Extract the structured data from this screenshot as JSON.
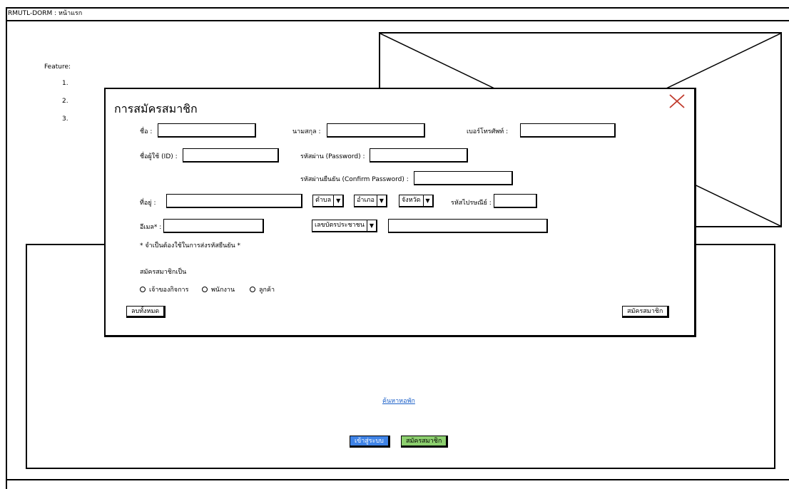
{
  "window": {
    "title": "RMUTL-DORM : หน้าแรก"
  },
  "background": {
    "feature_title": "Feature:",
    "feature_items": [
      "1.",
      "2.",
      "3."
    ],
    "search_link": "ค้นหาหอพัก",
    "login_button": "เข้าสู่ระบบ",
    "register_button": "สมัครสมาชิก"
  },
  "modal": {
    "title": "การสมัครสมาชิก",
    "fields": {
      "first_name_label": "ชื่อ :",
      "last_name_label": "นามสกุล :",
      "phone_label": "เบอร์โทรศัพท์ :",
      "username_label": "ชื่อผู้ใช้ (ID) :",
      "password_label": "รหัสผ่าน (Password) :",
      "confirm_password_label": "รหัสผ่านยืนยัน (Confirm Password) :",
      "address_label": "ที่อยู่ :",
      "subdistrict": "ตำบล",
      "district": "อำเภอ",
      "province": "จังหวัด",
      "postal_code_label": "รหัสไปรษณีย์ :",
      "email_label": "อีเมล* :",
      "id_type": "เลขบัตรประชาชน"
    },
    "email_note": "* จำเป็นต้องใช้ในการส่งรหัสยืนยัน *",
    "membership_label": "สมัครสมาชิกเป็น",
    "membership_options": [
      "เจ้าของกิจการ",
      "พนักงาน",
      "ลูกค้า"
    ],
    "clear_button": "ลบทั้งหมด",
    "submit_button": "สมัครสมาชิก"
  },
  "colors": {
    "login_button": "#3f83e6",
    "register_button": "#8ccf6e",
    "link": "#1a5fc8"
  }
}
